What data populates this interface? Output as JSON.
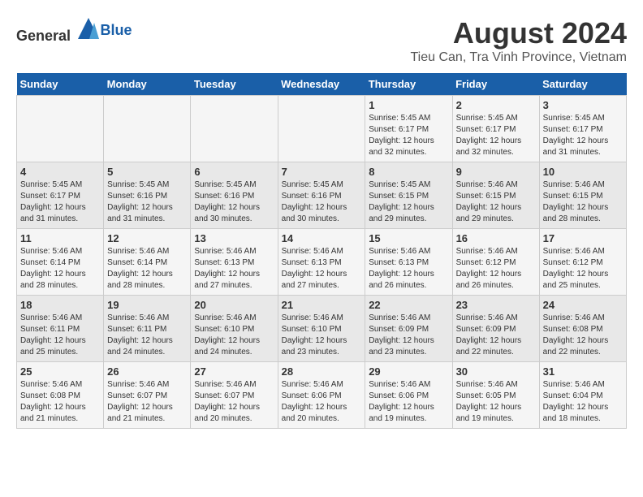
{
  "header": {
    "logo_general": "General",
    "logo_blue": "Blue",
    "main_title": "August 2024",
    "subtitle": "Tieu Can, Tra Vinh Province, Vietnam"
  },
  "calendar": {
    "days_of_week": [
      "Sunday",
      "Monday",
      "Tuesday",
      "Wednesday",
      "Thursday",
      "Friday",
      "Saturday"
    ],
    "weeks": [
      [
        {
          "day": "",
          "info": ""
        },
        {
          "day": "",
          "info": ""
        },
        {
          "day": "",
          "info": ""
        },
        {
          "day": "",
          "info": ""
        },
        {
          "day": "1",
          "info": "Sunrise: 5:45 AM\nSunset: 6:17 PM\nDaylight: 12 hours\nand 32 minutes."
        },
        {
          "day": "2",
          "info": "Sunrise: 5:45 AM\nSunset: 6:17 PM\nDaylight: 12 hours\nand 32 minutes."
        },
        {
          "day": "3",
          "info": "Sunrise: 5:45 AM\nSunset: 6:17 PM\nDaylight: 12 hours\nand 31 minutes."
        }
      ],
      [
        {
          "day": "4",
          "info": "Sunrise: 5:45 AM\nSunset: 6:17 PM\nDaylight: 12 hours\nand 31 minutes."
        },
        {
          "day": "5",
          "info": "Sunrise: 5:45 AM\nSunset: 6:16 PM\nDaylight: 12 hours\nand 31 minutes."
        },
        {
          "day": "6",
          "info": "Sunrise: 5:45 AM\nSunset: 6:16 PM\nDaylight: 12 hours\nand 30 minutes."
        },
        {
          "day": "7",
          "info": "Sunrise: 5:45 AM\nSunset: 6:16 PM\nDaylight: 12 hours\nand 30 minutes."
        },
        {
          "day": "8",
          "info": "Sunrise: 5:45 AM\nSunset: 6:15 PM\nDaylight: 12 hours\nand 29 minutes."
        },
        {
          "day": "9",
          "info": "Sunrise: 5:46 AM\nSunset: 6:15 PM\nDaylight: 12 hours\nand 29 minutes."
        },
        {
          "day": "10",
          "info": "Sunrise: 5:46 AM\nSunset: 6:15 PM\nDaylight: 12 hours\nand 28 minutes."
        }
      ],
      [
        {
          "day": "11",
          "info": "Sunrise: 5:46 AM\nSunset: 6:14 PM\nDaylight: 12 hours\nand 28 minutes."
        },
        {
          "day": "12",
          "info": "Sunrise: 5:46 AM\nSunset: 6:14 PM\nDaylight: 12 hours\nand 28 minutes."
        },
        {
          "day": "13",
          "info": "Sunrise: 5:46 AM\nSunset: 6:13 PM\nDaylight: 12 hours\nand 27 minutes."
        },
        {
          "day": "14",
          "info": "Sunrise: 5:46 AM\nSunset: 6:13 PM\nDaylight: 12 hours\nand 27 minutes."
        },
        {
          "day": "15",
          "info": "Sunrise: 5:46 AM\nSunset: 6:13 PM\nDaylight: 12 hours\nand 26 minutes."
        },
        {
          "day": "16",
          "info": "Sunrise: 5:46 AM\nSunset: 6:12 PM\nDaylight: 12 hours\nand 26 minutes."
        },
        {
          "day": "17",
          "info": "Sunrise: 5:46 AM\nSunset: 6:12 PM\nDaylight: 12 hours\nand 25 minutes."
        }
      ],
      [
        {
          "day": "18",
          "info": "Sunrise: 5:46 AM\nSunset: 6:11 PM\nDaylight: 12 hours\nand 25 minutes."
        },
        {
          "day": "19",
          "info": "Sunrise: 5:46 AM\nSunset: 6:11 PM\nDaylight: 12 hours\nand 24 minutes."
        },
        {
          "day": "20",
          "info": "Sunrise: 5:46 AM\nSunset: 6:10 PM\nDaylight: 12 hours\nand 24 minutes."
        },
        {
          "day": "21",
          "info": "Sunrise: 5:46 AM\nSunset: 6:10 PM\nDaylight: 12 hours\nand 23 minutes."
        },
        {
          "day": "22",
          "info": "Sunrise: 5:46 AM\nSunset: 6:09 PM\nDaylight: 12 hours\nand 23 minutes."
        },
        {
          "day": "23",
          "info": "Sunrise: 5:46 AM\nSunset: 6:09 PM\nDaylight: 12 hours\nand 22 minutes."
        },
        {
          "day": "24",
          "info": "Sunrise: 5:46 AM\nSunset: 6:08 PM\nDaylight: 12 hours\nand 22 minutes."
        }
      ],
      [
        {
          "day": "25",
          "info": "Sunrise: 5:46 AM\nSunset: 6:08 PM\nDaylight: 12 hours\nand 21 minutes."
        },
        {
          "day": "26",
          "info": "Sunrise: 5:46 AM\nSunset: 6:07 PM\nDaylight: 12 hours\nand 21 minutes."
        },
        {
          "day": "27",
          "info": "Sunrise: 5:46 AM\nSunset: 6:07 PM\nDaylight: 12 hours\nand 20 minutes."
        },
        {
          "day": "28",
          "info": "Sunrise: 5:46 AM\nSunset: 6:06 PM\nDaylight: 12 hours\nand 20 minutes."
        },
        {
          "day": "29",
          "info": "Sunrise: 5:46 AM\nSunset: 6:06 PM\nDaylight: 12 hours\nand 19 minutes."
        },
        {
          "day": "30",
          "info": "Sunrise: 5:46 AM\nSunset: 6:05 PM\nDaylight: 12 hours\nand 19 minutes."
        },
        {
          "day": "31",
          "info": "Sunrise: 5:46 AM\nSunset: 6:04 PM\nDaylight: 12 hours\nand 18 minutes."
        }
      ]
    ]
  }
}
